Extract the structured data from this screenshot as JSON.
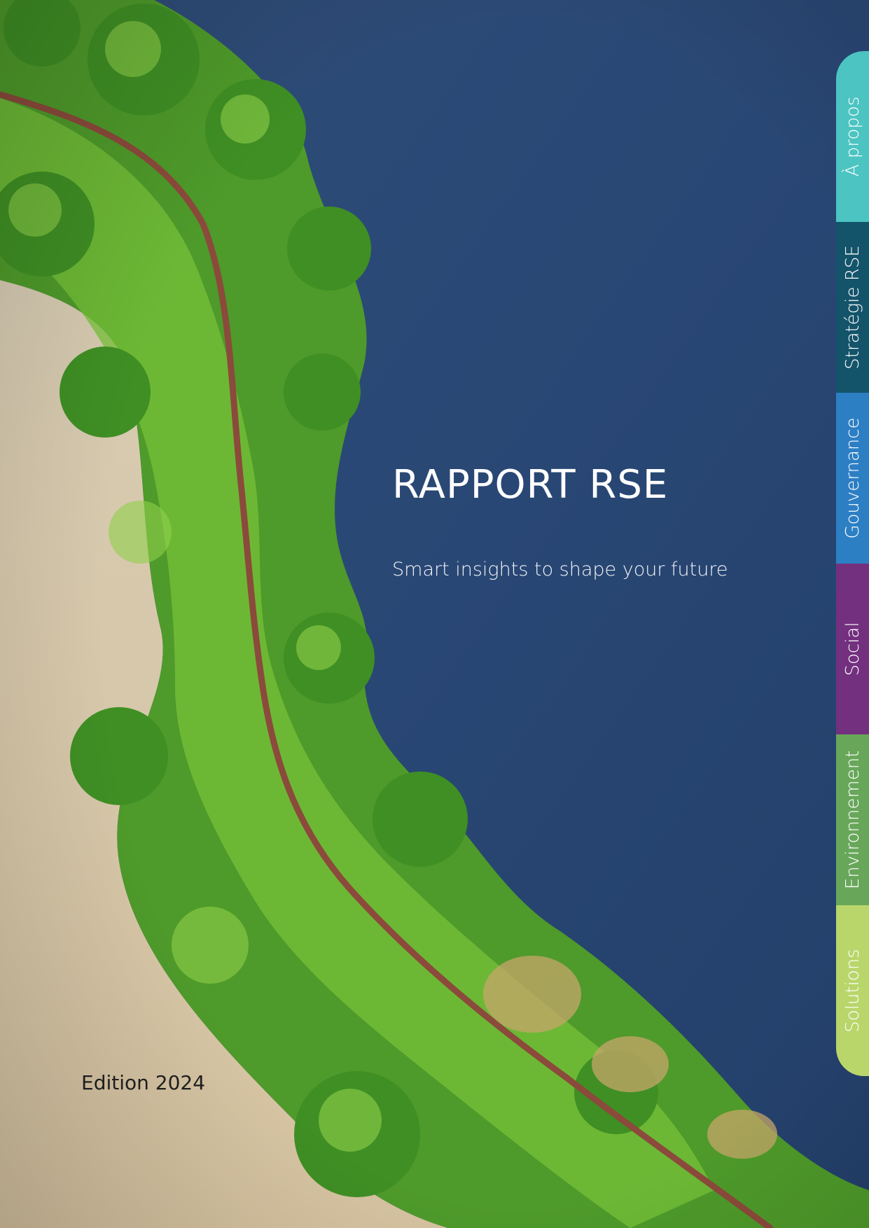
{
  "cover": {
    "title": "RAPPORT RSE",
    "subtitle": "Smart insights to shape your future",
    "edition": "Edition 2024"
  },
  "nav_tabs": [
    {
      "label": "À propos",
      "color": "#4cc4c1"
    },
    {
      "label": "Stratégie RSE",
      "color": "#14546a"
    },
    {
      "label": "Gouvernance",
      "color": "#2d7fc4"
    },
    {
      "label": "Social",
      "color": "#73307f"
    },
    {
      "label": "Environnement",
      "color": "#68a75a"
    },
    {
      "label": "Solutions",
      "color": "#b9d66a"
    }
  ],
  "colors": {
    "water": "#2b4a73",
    "land": "#d8c9aa",
    "vegetation": "#5fa82e",
    "path": "#8c4a3a"
  }
}
